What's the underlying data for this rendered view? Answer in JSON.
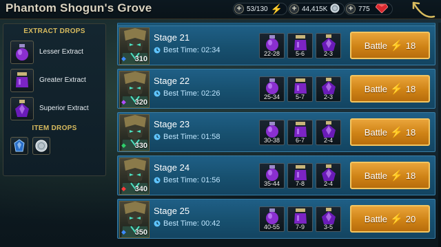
{
  "title": "Phantom Shogun's Grove",
  "resources": {
    "energy": "53/130",
    "silver": "44,415K",
    "gems": "775"
  },
  "colors": {
    "accent_gold": "#d8bb5e",
    "stage_row": "#1f5f86",
    "battle_button": "#cf8316",
    "energy_bolt": "#c9e81a"
  },
  "sidebar": {
    "extract_header": "EXTRACT DROPS",
    "extracts": [
      {
        "label": "Lesser Extract",
        "icon": "lesser-extract-icon"
      },
      {
        "label": "Greater Extract",
        "icon": "greater-extract-icon"
      },
      {
        "label": "Superior Extract",
        "icon": "superior-extract-icon"
      }
    ],
    "item_header": "ITEM DROPS",
    "items": [
      {
        "icon": "artifact-icon"
      },
      {
        "icon": "silver-coin-icon"
      }
    ]
  },
  "stages": [
    {
      "name": "Stage 21",
      "best_time": "Best Time: 02:34",
      "level": "310",
      "drops": [
        "22-28",
        "5-6",
        "2-3"
      ],
      "battle": "Battle",
      "cost": "18"
    },
    {
      "name": "Stage 22",
      "best_time": "Best Time: 02:26",
      "level": "320",
      "drops": [
        "25-34",
        "5-7",
        "2-3"
      ],
      "battle": "Battle",
      "cost": "18"
    },
    {
      "name": "Stage 23",
      "best_time": "Best Time: 01:58",
      "level": "330",
      "drops": [
        "30-38",
        "6-7",
        "2-4"
      ],
      "battle": "Battle",
      "cost": "18"
    },
    {
      "name": "Stage 24",
      "best_time": "Best Time: 01:56",
      "level": "340",
      "drops": [
        "35-44",
        "7-8",
        "2-4"
      ],
      "battle": "Battle",
      "cost": "18"
    },
    {
      "name": "Stage 25",
      "best_time": "Best Time: 00:42",
      "level": "350",
      "drops": [
        "40-55",
        "7-9",
        "3-5"
      ],
      "battle": "Battle",
      "cost": "20"
    }
  ]
}
